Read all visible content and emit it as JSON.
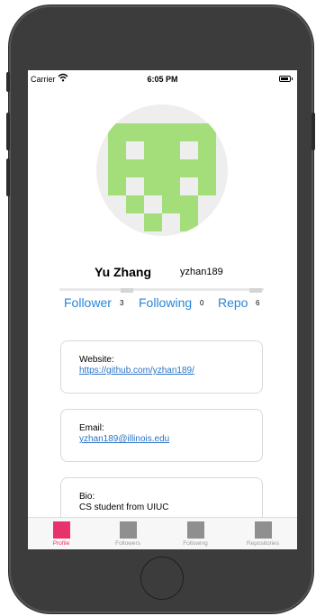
{
  "status_bar": {
    "carrier": "Carrier",
    "time": "6:05 PM"
  },
  "profile": {
    "name": "Yu Zhang",
    "login": "yzhan189"
  },
  "stats": [
    {
      "label": "Follower",
      "count": "3"
    },
    {
      "label": "Following",
      "count": "0"
    },
    {
      "label": "Repo",
      "count": "6"
    }
  ],
  "cards": {
    "website": {
      "label": "Website:",
      "value": "https://github.com/yzhan189/"
    },
    "email": {
      "label": "Email:",
      "value": "yzhan189@illinois.edu"
    },
    "bio": {
      "label": "Bio:",
      "value": "CS student from UIUC"
    }
  },
  "tabbar": {
    "items": [
      {
        "label": "Profile",
        "active": true
      },
      {
        "label": "Followers",
        "active": false
      },
      {
        "label": "Following",
        "active": false
      },
      {
        "label": "Repositories",
        "active": false
      }
    ]
  },
  "colors": {
    "accent": "#e8326b",
    "link": "#2a86d9",
    "identicon": "#a3de7b",
    "identicon_bg": "#eeeeee"
  },
  "icons": [
    "wifi-icon",
    "battery-icon",
    "avatar-identicon",
    "tab-icon"
  ]
}
